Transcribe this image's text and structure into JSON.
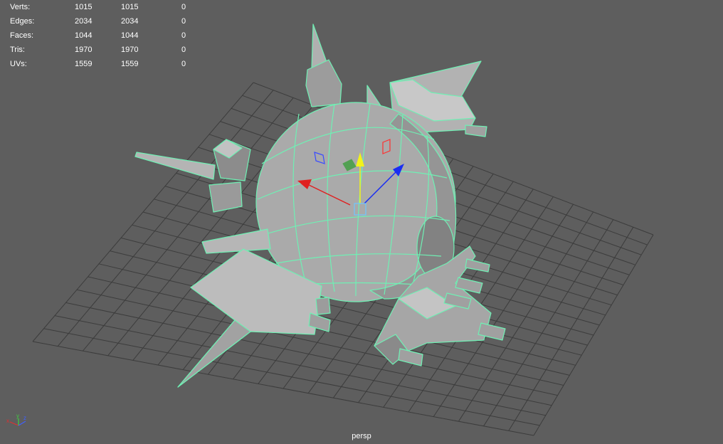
{
  "heads_up_display": {
    "rows": [
      {
        "label": "Verts:",
        "c1": "1015",
        "c2": "1015",
        "c3": "0"
      },
      {
        "label": "Edges:",
        "c1": "2034",
        "c2": "2034",
        "c3": "0"
      },
      {
        "label": "Faces:",
        "c1": "1044",
        "c2": "1044",
        "c3": "0"
      },
      {
        "label": "Tris:",
        "c1": "1970",
        "c2": "1970",
        "c3": "0"
      },
      {
        "label": "UVs:",
        "c1": "1559",
        "c2": "1559",
        "c3": "0"
      }
    ]
  },
  "camera": {
    "name": "persp"
  },
  "axis_indicator": {
    "x_label": "x",
    "y_label": "y",
    "z_label": "z"
  },
  "colors": {
    "viewport_bg": "#5e5e5e",
    "grid_line": "#3c3c3c",
    "wireframe": "#6ff0b4",
    "mesh_fill": "#a9a9a9",
    "manip_x": "#e02020",
    "manip_y": "#f2f21a",
    "manip_z": "#1a2ef2"
  },
  "icons": {
    "manipulator": "move-manipulator-icon",
    "axis": "view-axis-icon"
  }
}
